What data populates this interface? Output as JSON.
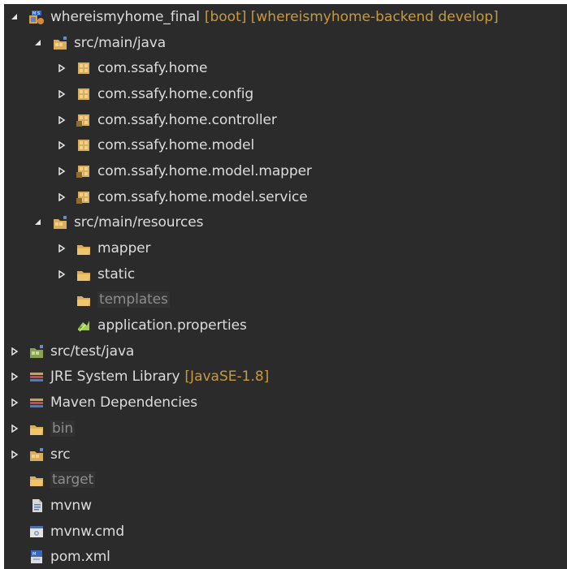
{
  "project": {
    "name": "whereismyhome_final",
    "tags": "[boot] [whereismyhome-backend develop]"
  },
  "main_java": {
    "label": "src/main/java",
    "packages": [
      "com.ssafy.home",
      "com.ssafy.home.config",
      "com.ssafy.home.controller",
      "com.ssafy.home.model",
      "com.ssafy.home.model.mapper",
      "com.ssafy.home.model.service"
    ]
  },
  "main_resources": {
    "label": "src/main/resources",
    "children": [
      "mapper",
      "static",
      "templates",
      "application.properties"
    ]
  },
  "root_items": {
    "test_java": "src/test/java",
    "jre": "JRE System Library",
    "jre_version": "[JavaSE-1.8]",
    "maven": "Maven Dependencies",
    "bin": "bin",
    "src": "src",
    "target": "target",
    "mvnw": "mvnw",
    "mvnw_cmd": "mvnw.cmd",
    "pom": "pom.xml"
  },
  "icons": {
    "expanded": "expanded-arrow-icon",
    "collapsed": "collapsed-arrow-icon",
    "project": "maven-project-icon",
    "source_folder": "source-folder-icon",
    "package": "package-icon",
    "folder": "folder-icon",
    "properties": "properties-file-icon",
    "library": "library-icon",
    "file": "file-icon",
    "command_file": "command-file-icon",
    "pom_file": "pom-file-icon"
  },
  "colors": {
    "background": "#2b2b2b",
    "text": "#dcdcdc",
    "muted": "#8c8c8c",
    "meta": "#c89a3b"
  }
}
